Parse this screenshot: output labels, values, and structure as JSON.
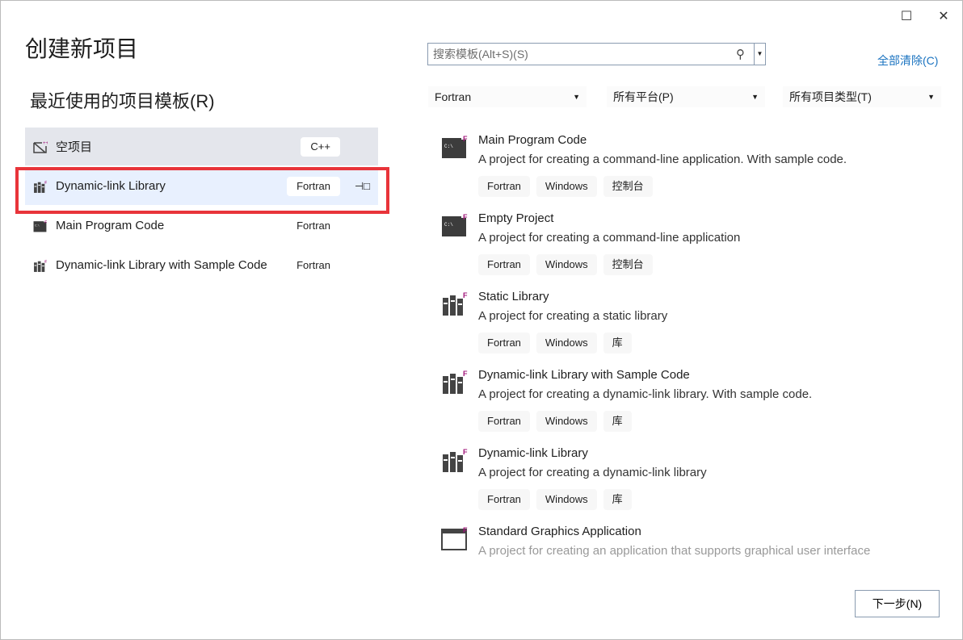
{
  "title": "创建新项目",
  "recent_heading": "最近使用的项目模板(R)",
  "window": {
    "maximize": "☐",
    "close": "✕"
  },
  "recent": [
    {
      "label": "空项目",
      "tag": "C++",
      "icon": "empty-project-icon"
    },
    {
      "label": "Dynamic-link Library",
      "tag": "Fortran",
      "icon": "library-icon",
      "pin": "⊣□"
    },
    {
      "label": "Main Program Code",
      "tag": "Fortran",
      "icon": "console-icon"
    },
    {
      "label": "Dynamic-link Library with Sample Code",
      "tag": "Fortran",
      "icon": "library-icon"
    }
  ],
  "search": {
    "placeholder": "搜索模板(Alt+S)(S)"
  },
  "clear_all": "全部清除(C)",
  "filters": {
    "language": "Fortran",
    "platform": "所有平台(P)",
    "type": "所有项目类型(T)"
  },
  "templates": [
    {
      "name": "Main Program Code",
      "desc": "A project for creating a command-line application. With sample code.",
      "tags": [
        "Fortran",
        "Windows",
        "控制台"
      ],
      "icon": "console"
    },
    {
      "name": "Empty Project",
      "desc": "A project for creating a command-line application",
      "tags": [
        "Fortran",
        "Windows",
        "控制台"
      ],
      "icon": "console"
    },
    {
      "name": "Static Library",
      "desc": "A project for creating a static library",
      "tags": [
        "Fortran",
        "Windows",
        "库"
      ],
      "icon": "library"
    },
    {
      "name": "Dynamic-link Library with Sample Code",
      "desc": "A project for creating a dynamic-link library. With sample code.",
      "tags": [
        "Fortran",
        "Windows",
        "库"
      ],
      "icon": "library"
    },
    {
      "name": "Dynamic-link Library",
      "desc": "A project for creating a dynamic-link library",
      "tags": [
        "Fortran",
        "Windows",
        "库"
      ],
      "icon": "library"
    },
    {
      "name": "Standard Graphics Application",
      "desc": "A project for creating an application that supports graphical user interface",
      "tags": [],
      "icon": "window"
    }
  ],
  "next_button": "下一步(N)",
  "colors": {
    "accent": "#1a73c0",
    "highlight": "#e8343a",
    "fortran": "#a0167a"
  }
}
